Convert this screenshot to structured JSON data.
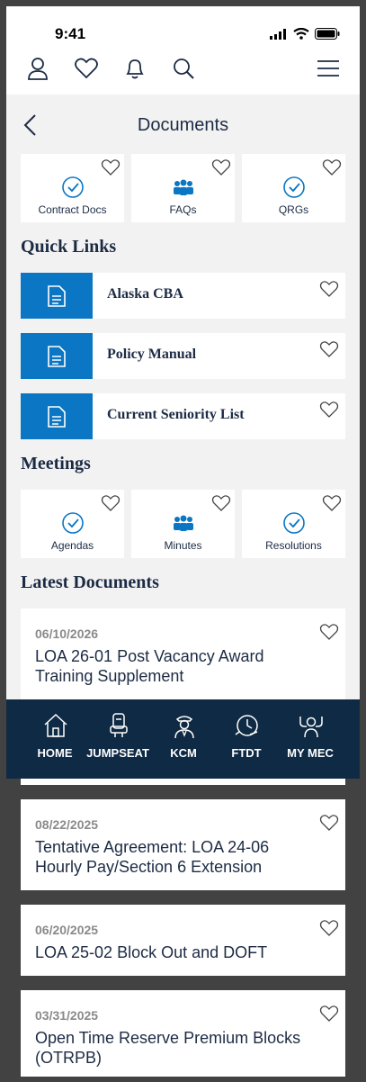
{
  "status": {
    "time": "9:41"
  },
  "header": {
    "title": "Documents"
  },
  "top_tiles": [
    {
      "label": "Contract Docs",
      "icon": "check-circle-icon"
    },
    {
      "label": "FAQs",
      "icon": "people-icon"
    },
    {
      "label": "QRGs",
      "icon": "check-circle-icon"
    }
  ],
  "quick_links": {
    "title": "Quick Links",
    "items": [
      {
        "label": "Alaska CBA"
      },
      {
        "label": "Policy Manual"
      },
      {
        "label": "Current Seniority List"
      }
    ]
  },
  "meetings": {
    "title": "Meetings",
    "tiles": [
      {
        "label": "Agendas",
        "icon": "check-circle-icon"
      },
      {
        "label": "Minutes",
        "icon": "people-icon"
      },
      {
        "label": "Resolutions",
        "icon": "check-circle-icon"
      }
    ]
  },
  "latest": {
    "title": "Latest Documents",
    "items": [
      {
        "date": "06/10/2026",
        "title": "LOA 26-01 Post Vacancy Award Training Supplement"
      },
      {
        "date": "08/22/2025",
        "title": "Tentative Agreement: LOA 24-06 Hourly Pay/Section 6 Extension"
      },
      {
        "date": "06/20/2025",
        "title": "LOA 25-02 Block Out and DOFT"
      },
      {
        "date": "03/31/2025",
        "title": "Open Time Reserve Premium Blocks (OTRPB)"
      }
    ]
  },
  "bottom_nav": [
    {
      "label": "HOME",
      "icon": "home-icon"
    },
    {
      "label": "JUMPSEAT",
      "icon": "seat-icon"
    },
    {
      "label": "KCM",
      "icon": "pilot-icon"
    },
    {
      "label": "FTDT",
      "icon": "clock-icon"
    },
    {
      "label": "MY MEC",
      "icon": "mec-icon"
    }
  ],
  "colors": {
    "navy": "#0f2a44",
    "accent": "#0a76c4",
    "text": "#1c2b44"
  }
}
